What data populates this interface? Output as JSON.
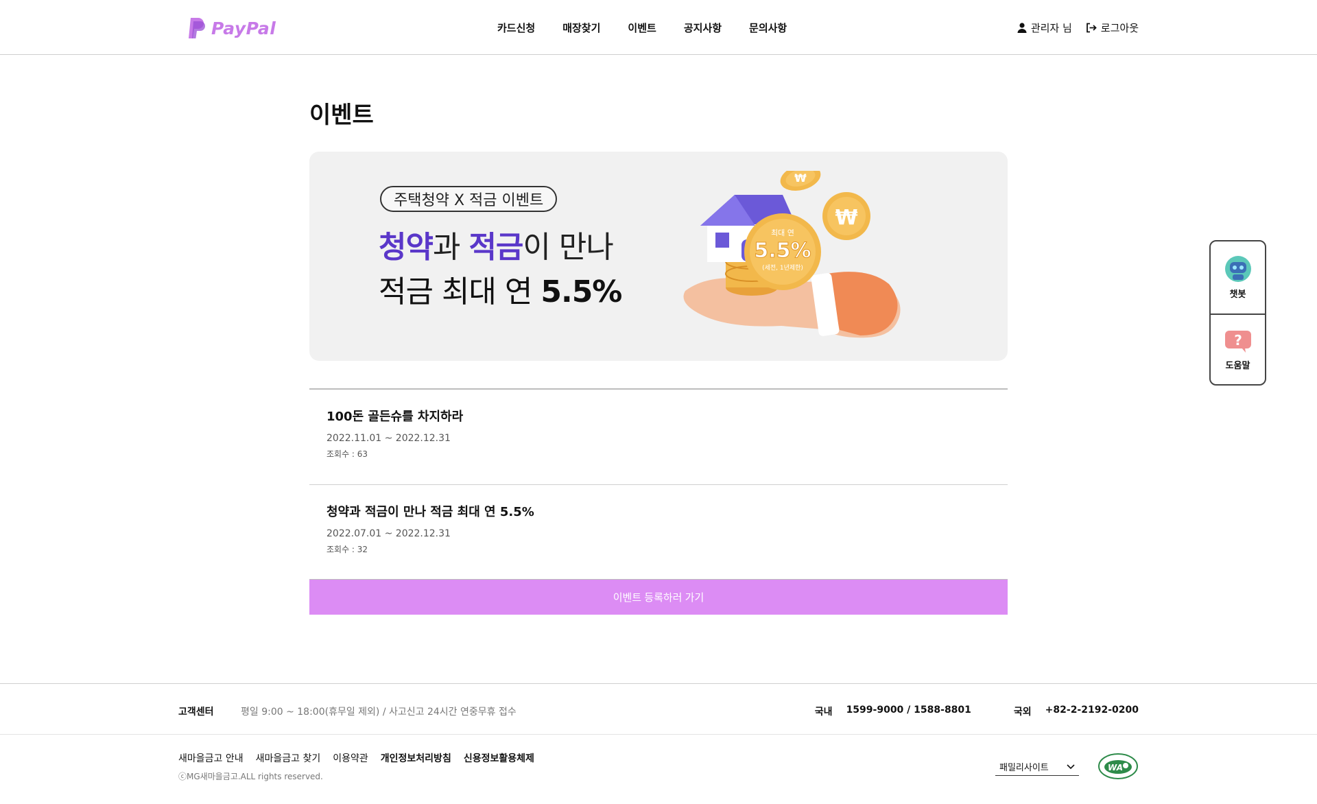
{
  "header": {
    "logo_text": "PayPal",
    "nav": [
      "카드신청",
      "매장찾기",
      "이벤트",
      "공지사항",
      "문의사항"
    ],
    "user_label": "관리자 님",
    "logout_label": "로그아웃"
  },
  "main": {
    "title": "이벤트",
    "banner": {
      "pill": "주택청약 X 적금 이벤트",
      "line1_a": "청약",
      "line1_b": "과 ",
      "line1_c": "적금",
      "line1_d": "이 만나",
      "line2_a": "적금 최대 연 ",
      "line2_b": "5.5%",
      "coin_top": "최대 연",
      "coin_rate": "5.5%",
      "coin_note": "(세전, 1년제한)",
      "coin_symbol": "₩"
    },
    "events": [
      {
        "title": "100돈 골든슈를 차지하라",
        "period": "2022.11.01 ~ 2022.12.31",
        "views": "조회수 : 63"
      },
      {
        "title": "청약과 적금이 만나 적금 최대 연 5.5%",
        "period": "2022.07.01 ~ 2022.12.31",
        "views": "조회수 : 32"
      }
    ],
    "register_label": "이벤트 등록하러 가기"
  },
  "side": {
    "chatbot_label": "챗봇",
    "help_label": "도움말"
  },
  "footer": {
    "cs_title": "고객센터",
    "cs_desc": "평일 9:00 ~ 18:00(휴무일 제외) / 사고신고 24시간 연중무휴 접수",
    "domestic_label": "국내",
    "domestic_number": "1599-9000 / 1588-8801",
    "overseas_label": "국외",
    "overseas_number": "+82-2-2192-0200",
    "links": [
      "새마을금고 안내",
      "새마을금고 찾기",
      "이용약관",
      "개인정보처리방침",
      "신용정보활용체제"
    ],
    "copyright": "ⓒMG새마을금고.ALL rights reserved.",
    "family_site": "패밀리사이트",
    "wa_text": "WA"
  },
  "colors": {
    "accent": "#dc8cf4",
    "logo": "#c77ae8",
    "banner_highlight": "#5a37c9"
  }
}
